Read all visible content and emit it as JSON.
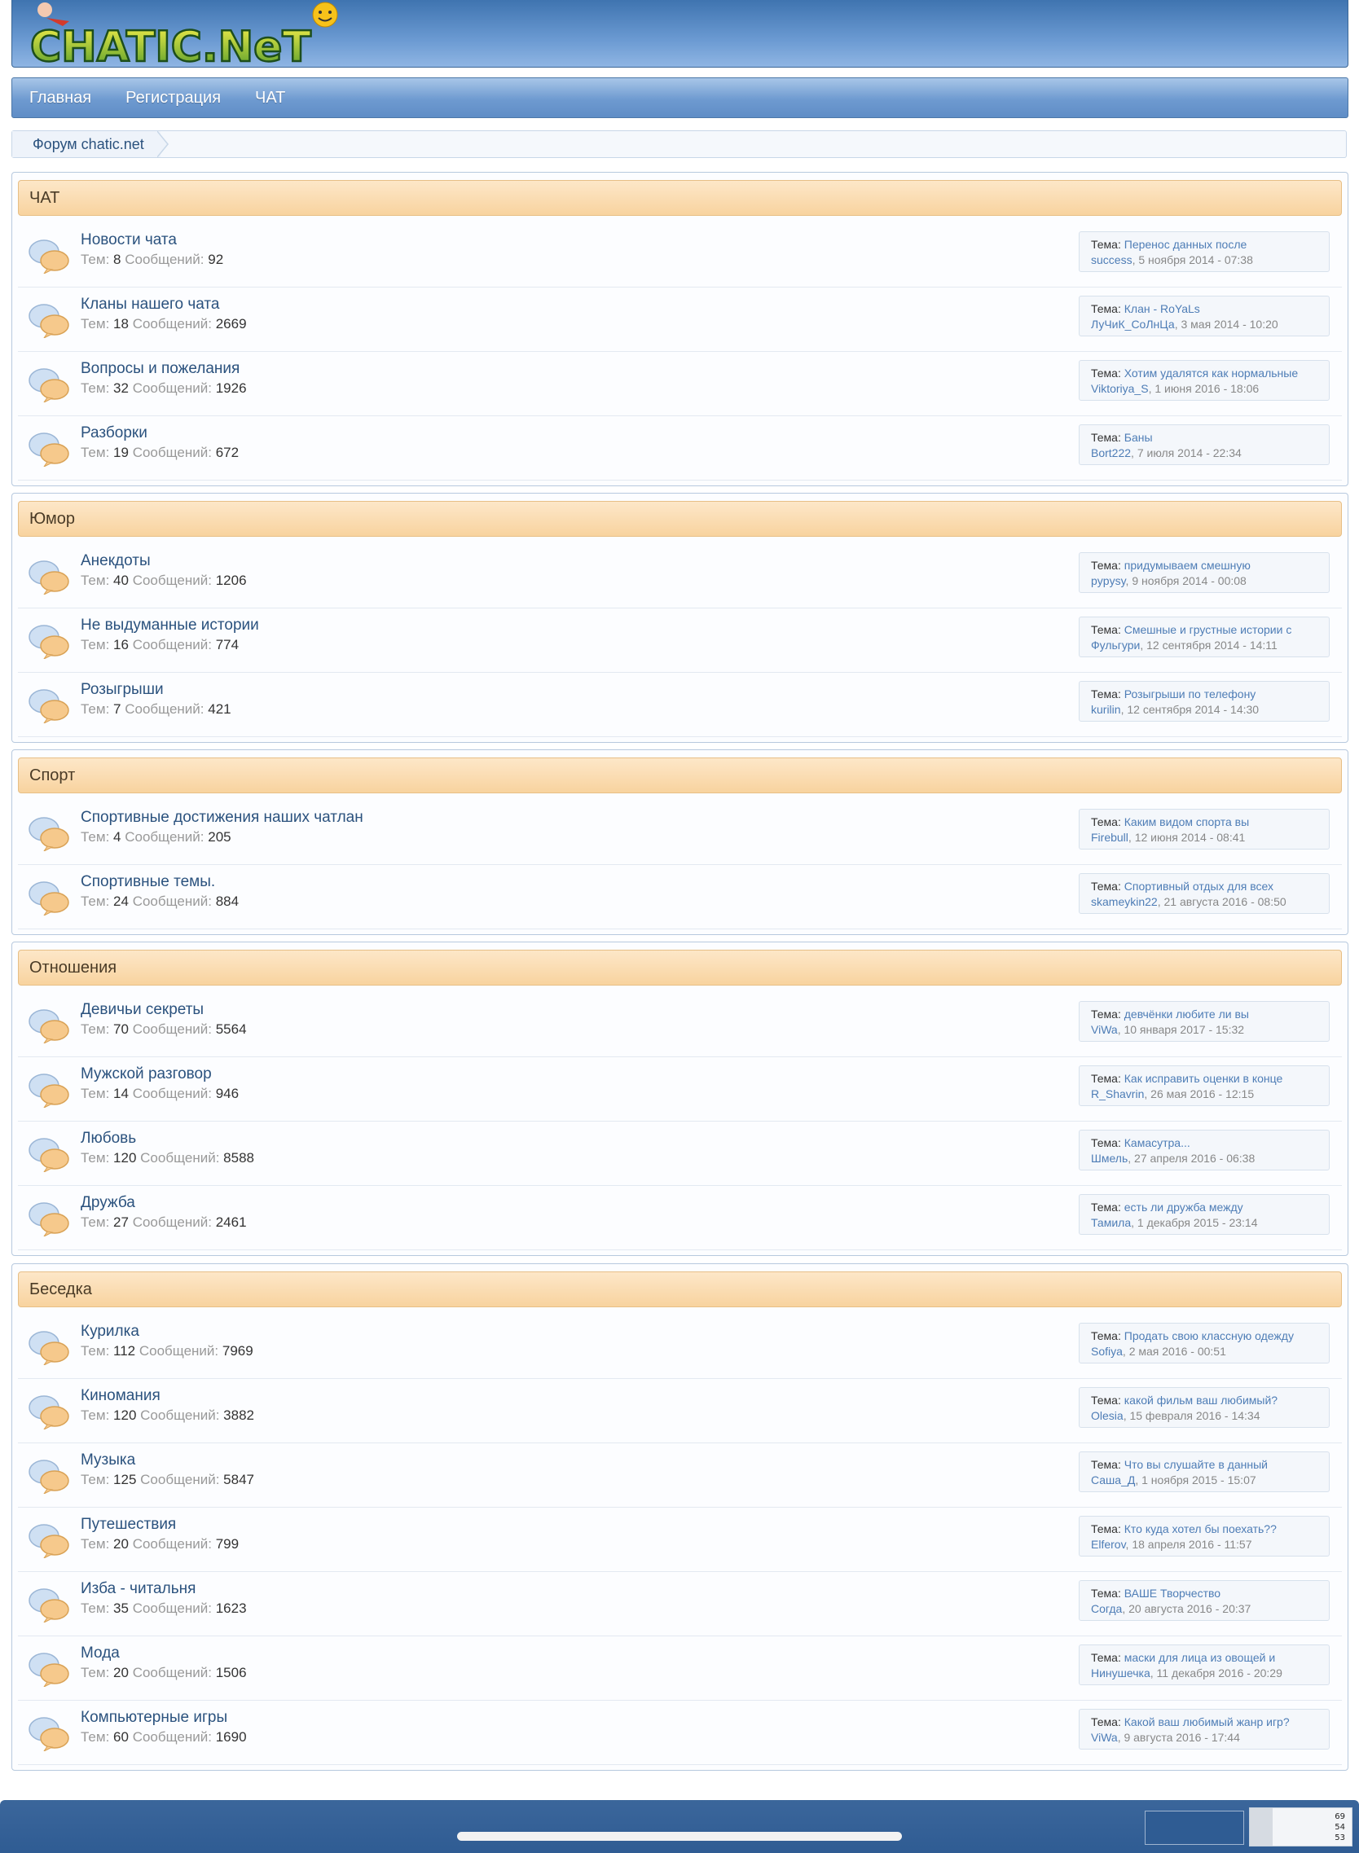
{
  "site": {
    "logo_text": "CHATIC.NeT"
  },
  "nav": {
    "items": [
      "Главная",
      "Регистрация",
      "ЧАТ"
    ]
  },
  "breadcrumb": {
    "label": "Форум chatic.net"
  },
  "labels": {
    "threads": "Тем:",
    "messages": "Сообщений:",
    "topic": "Тема:"
  },
  "categories": [
    {
      "title": "ЧАТ",
      "forums": [
        {
          "title": "Новости чата",
          "threads": "8",
          "messages": "92",
          "last_topic": "Перенос данных после",
          "last_user": "success",
          "last_date": "5 ноября 2014 - 07:38"
        },
        {
          "title": "Кланы нашего чата",
          "threads": "18",
          "messages": "2669",
          "last_topic": "Клан - RoYaLs",
          "last_user": "ЛуЧиК_СоЛнЦа",
          "last_date": "3 мая 2014 - 10:20"
        },
        {
          "title": "Вопросы и пожелания",
          "threads": "32",
          "messages": "1926",
          "last_topic": "Хотим удалятся как нормальные",
          "last_user": "Viktoriya_S",
          "last_date": "1 июня 2016 - 18:06"
        },
        {
          "title": "Разборки",
          "threads": "19",
          "messages": "672",
          "last_topic": "Баны",
          "last_user": "Bort222",
          "last_date": "7 июля 2014 - 22:34"
        }
      ]
    },
    {
      "title": "Юмор",
      "forums": [
        {
          "title": "Анекдоты",
          "threads": "40",
          "messages": "1206",
          "last_topic": "придумываем смешную",
          "last_user": "pypysy",
          "last_date": "9 ноября 2014 - 00:08"
        },
        {
          "title": "Не выдуманные истории",
          "threads": "16",
          "messages": "774",
          "last_topic": "Смешные и грустные истории с",
          "last_user": "Фульгури",
          "last_date": "12 сентября 2014 - 14:11"
        },
        {
          "title": "Розыгрыши",
          "threads": "7",
          "messages": "421",
          "last_topic": "Розыгрыши по телефону",
          "last_user": "kurilin",
          "last_date": "12 сентября 2014 - 14:30"
        }
      ]
    },
    {
      "title": "Спорт",
      "forums": [
        {
          "title": "Спортивные достижения наших чатлан",
          "threads": "4",
          "messages": "205",
          "last_topic": "Каким видом спорта вы",
          "last_user": "Firebull",
          "last_date": "12 июня 2014 - 08:41"
        },
        {
          "title": "Спортивные темы.",
          "threads": "24",
          "messages": "884",
          "last_topic": "Спортивный отдых для всех",
          "last_user": "skameykin22",
          "last_date": "21 августа 2016 - 08:50"
        }
      ]
    },
    {
      "title": "Отношения",
      "forums": [
        {
          "title": "Девичьи секреты",
          "threads": "70",
          "messages": "5564",
          "last_topic": "девчёнки любите ли вы",
          "last_user": "ViWa",
          "last_date": "10 января 2017 - 15:32"
        },
        {
          "title": "Мужской разговор",
          "threads": "14",
          "messages": "946",
          "last_topic": "Как исправить оценки в конце",
          "last_user": "R_Shavrin",
          "last_date": "26 мая 2016 - 12:15"
        },
        {
          "title": "Любовь",
          "threads": "120",
          "messages": "8588",
          "last_topic": "Камасутра...",
          "last_user": "Шмель",
          "last_date": "27 апреля 2016 - 06:38"
        },
        {
          "title": "Дружба",
          "threads": "27",
          "messages": "2461",
          "last_topic": "есть ли дружба между",
          "last_user": "Тамила",
          "last_date": "1 декабря 2015 - 23:14"
        }
      ]
    },
    {
      "title": "Беседка",
      "forums": [
        {
          "title": "Курилка",
          "threads": "112",
          "messages": "7969",
          "last_topic": "Продать свою классную одежду",
          "last_user": "Sofiya",
          "last_date": "2 мая 2016 - 00:51"
        },
        {
          "title": "Киномания",
          "threads": "120",
          "messages": "3882",
          "last_topic": "какой фильм ваш любимый?",
          "last_user": "Olesia",
          "last_date": "15 февраля 2016 - 14:34"
        },
        {
          "title": "Музыка",
          "threads": "125",
          "messages": "5847",
          "last_topic": "Что вы слушайте в данный",
          "last_user": "Саша_Д",
          "last_date": "1 ноября 2015 - 15:07"
        },
        {
          "title": "Путешествия",
          "threads": "20",
          "messages": "799",
          "last_topic": "Кто куда хотел бы поехать??",
          "last_user": "Elferov",
          "last_date": "18 апреля 2016 - 11:57"
        },
        {
          "title": "Изба - читальня",
          "threads": "35",
          "messages": "1623",
          "last_topic": "ВАШЕ Творчество",
          "last_user": "Согда",
          "last_date": "20 августа 2016 - 20:37"
        },
        {
          "title": "Мода",
          "threads": "20",
          "messages": "1506",
          "last_topic": "маски для лица из овощей и",
          "last_user": "Нинушечка",
          "last_date": "11 декабря 2016 - 20:29"
        },
        {
          "title": "Компьютерные игры",
          "threads": "60",
          "messages": "1690",
          "last_topic": "Какой ваш любимый жанр игр?",
          "last_user": "ViWa",
          "last_date": "9 августа 2016 - 17:44"
        }
      ]
    }
  ],
  "counter": {
    "lines": [
      "69",
      "54",
      "53"
    ]
  },
  "colors": {
    "header_blue": "#4f82bf",
    "category_orange": "#f8d39f",
    "link_blue": "#2b527e",
    "footer_blue": "#2f5c93"
  }
}
